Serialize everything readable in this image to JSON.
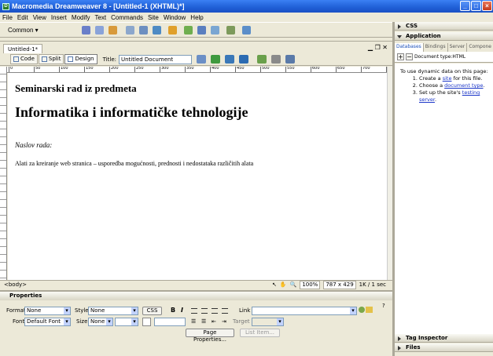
{
  "window": {
    "title": "Macromedia Dreamweaver 8 - [Untitled-1 (XHTML)*]"
  },
  "menubar": [
    "File",
    "Edit",
    "View",
    "Insert",
    "Modify",
    "Text",
    "Commands",
    "Site",
    "Window",
    "Help"
  ],
  "insertbar": {
    "category": "Common"
  },
  "document": {
    "tab": "Untitled-1*",
    "views": {
      "code": "Code",
      "split": "Split",
      "design": "Design"
    },
    "title_label": "Title:",
    "title_value": "Untitled Document",
    "ruler_labels": [
      "0",
      "50",
      "100",
      "150",
      "200",
      "250",
      "300",
      "350",
      "400",
      "450",
      "500",
      "550",
      "600",
      "650",
      "700",
      "750"
    ],
    "content": {
      "heading2": "Seminarski rad iz predmeta",
      "heading1": "Informatika i informatičke tehnologije",
      "label": "Naslov rada:",
      "paragraph": "Alati za kreiranje web stranica – usporedba mogućnosti, prednosti i nedostataka različitih alata"
    }
  },
  "status": {
    "tag": "<body>",
    "zoom": "100%",
    "size": "787 x 429",
    "download": "1K / 1 sec"
  },
  "properties": {
    "title": "Properties",
    "format_label": "Format",
    "format_value": "None",
    "style_label": "Style",
    "style_value": "None",
    "css_button": "CSS",
    "link_label": "Link",
    "font_label": "Font",
    "font_value": "Default Font",
    "size_label": "Size",
    "size_value": "None",
    "target_label": "Target",
    "page_properties_button": "Page Properties...",
    "list_item_button": "List Item..."
  },
  "panels": {
    "css": "CSS",
    "application": "Application",
    "tabs": [
      "Databases",
      "Bindings",
      "Server B",
      "Compone"
    ],
    "doctype": "Document type:HTML",
    "intro": "To use dynamic data on this page:",
    "steps": [
      {
        "pre": "Create a ",
        "link": "site",
        "post": " for this file."
      },
      {
        "pre": "Choose a ",
        "link": "document type",
        "post": "."
      },
      {
        "pre": "Set up the site's ",
        "link": "testing server",
        "post": "."
      }
    ],
    "tag_inspector": "Tag Inspector",
    "files": "Files"
  },
  "colors": {
    "titlebar": "#1f5fd6",
    "chrome": "#ece9d8",
    "link": "#1a35c8"
  }
}
